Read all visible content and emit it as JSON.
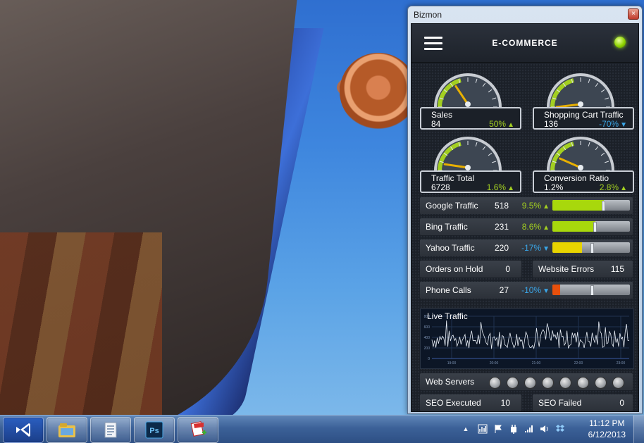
{
  "window": {
    "title": "Bizmon",
    "close_glyph": "×"
  },
  "header": {
    "title": "E-COMMERCE",
    "menu_icon": "hamburger-menu-icon",
    "status_color": "#8fd400"
  },
  "gauges": [
    {
      "name": "Sales",
      "value": "84",
      "pct": "50%",
      "trend": "up"
    },
    {
      "name": "Shopping Cart Traffic",
      "value": "136",
      "pct": "-70%",
      "trend": "down"
    },
    {
      "name": "Traffic Total",
      "value": "6728",
      "pct": "1.6%",
      "trend": "up"
    },
    {
      "name": "Conversion Ratio",
      "value": "1.2%",
      "pct": "2.8%",
      "trend": "up"
    }
  ],
  "traffic_rows": [
    {
      "label": "Google Traffic",
      "value": "518",
      "pct": "9.5%",
      "trend": "up",
      "fill_fraction": 0.66,
      "marker_fraction": 0.64,
      "color": "#a8d80c"
    },
    {
      "label": "Bing Traffic",
      "value": "231",
      "pct": "8.6%",
      "trend": "up",
      "fill_fraction": 0.55,
      "marker_fraction": 0.53,
      "color": "#a8d80c"
    },
    {
      "label": "Yahoo Traffic",
      "value": "220",
      "pct": "-17%",
      "trend": "down",
      "fill_fraction": 0.38,
      "marker_fraction": 0.49,
      "color": "#e8d400"
    },
    {
      "label": "Phone Calls",
      "value": "27",
      "pct": "-10%",
      "trend": "down",
      "fill_fraction": 0.1,
      "marker_fraction": 0.49,
      "color": "#e8500c"
    }
  ],
  "orders_on_hold": {
    "label": "Orders on Hold",
    "value": "0"
  },
  "website_errors": {
    "label": "Website Errors",
    "value": "115"
  },
  "live_traffic": {
    "title": "Live Traffic",
    "y_ticks": [
      "800",
      "600",
      "400",
      "200",
      "0"
    ],
    "x_ticks": [
      "19:00",
      "20:00",
      "21:00",
      "22:00",
      "23:00"
    ]
  },
  "web_servers": {
    "label": "Web Servers",
    "count": 8
  },
  "seo_executed": {
    "label": "SEO Executed",
    "value": "10"
  },
  "seo_failed": {
    "label": "SEO Failed",
    "value": "0"
  },
  "taskbar": {
    "apps": [
      "visual-studio-icon",
      "file-explorer-icon",
      "documents-icon",
      "photoshop-icon",
      "app-installer-icon"
    ],
    "photoshop_text": "Ps",
    "show_hidden_glyph": "▲",
    "clock_time": "11:12 PM",
    "clock_date": "6/12/2013"
  },
  "colors": {
    "up": "#a3cf21",
    "down": "#3aa6e8",
    "needle": "#e8b000",
    "gauge_arc": "#a3cf21"
  }
}
